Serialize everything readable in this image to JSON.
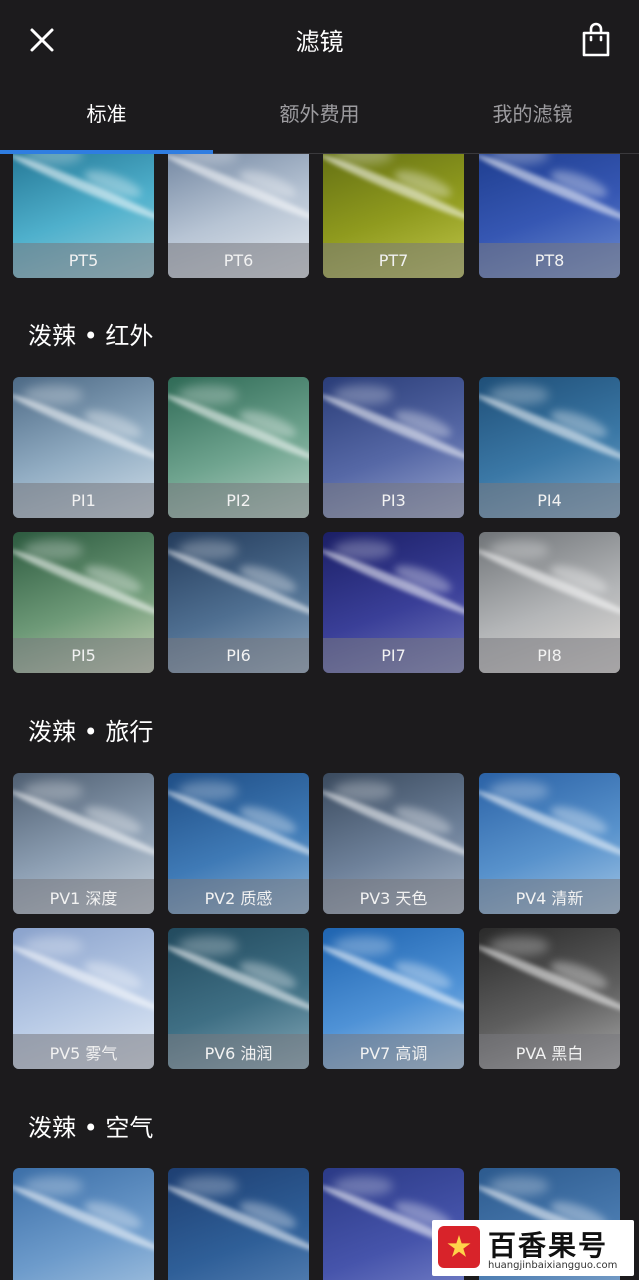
{
  "header": {
    "title": "滤镜",
    "close_icon": "close-icon",
    "store_icon": "shopping-bag-icon"
  },
  "tabs": [
    {
      "label": "标准",
      "active": true
    },
    {
      "label": "额外费用",
      "active": false
    },
    {
      "label": "我的滤镜",
      "active": false
    }
  ],
  "colors": {
    "background": "#1c1b1d",
    "accent": "#2f7de1"
  },
  "sections": [
    {
      "title": "",
      "filters": [
        {
          "label": "PT5",
          "tint": [
            "#1e6f8e",
            "#4fb0cc",
            "#9ad2de"
          ]
        },
        {
          "label": "PT6",
          "tint": [
            "#6a7f9b",
            "#b7c4d4",
            "#e5eaf0"
          ]
        },
        {
          "label": "PT7",
          "tint": [
            "#5e6a12",
            "#8f9a1e",
            "#c0c64a"
          ]
        },
        {
          "label": "PT8",
          "tint": [
            "#1b3a8a",
            "#3657b3",
            "#6f8ed1"
          ]
        }
      ]
    },
    {
      "title": "泼辣 • 红外",
      "filters": [
        {
          "label": "PI1",
          "tint": [
            "#4d6a86",
            "#93aec4",
            "#cfdde8"
          ]
        },
        {
          "label": "PI2",
          "tint": [
            "#2f6a56",
            "#6fa48f",
            "#b7d3c6"
          ]
        },
        {
          "label": "PI3",
          "tint": [
            "#2a3d78",
            "#5668a6",
            "#9aa6cf"
          ]
        },
        {
          "label": "PI4",
          "tint": [
            "#1f4f78",
            "#3b78a6",
            "#7aa8cc"
          ]
        },
        {
          "label": "PI5",
          "tint": [
            "#2c5a3f",
            "#6e9a78",
            "#c8d3b6"
          ]
        },
        {
          "label": "PI6",
          "tint": [
            "#243c5c",
            "#4f6f91",
            "#8fa8c0"
          ]
        },
        {
          "label": "PI7",
          "tint": [
            "#1b1f66",
            "#3a3f98",
            "#7479bd"
          ]
        },
        {
          "label": "PI8",
          "tint": [
            "#707478",
            "#b4b6b8",
            "#e0dcd8"
          ]
        }
      ]
    },
    {
      "title": "泼辣 • 旅行",
      "filters": [
        {
          "label": "PV1 深度",
          "tint": [
            "#4f5f72",
            "#8ea0b4",
            "#c8d2dc"
          ]
        },
        {
          "label": "PV2 质感",
          "tint": [
            "#1f4e86",
            "#3f7ab6",
            "#8db5d9"
          ]
        },
        {
          "label": "PV3 天色",
          "tint": [
            "#3a4a5e",
            "#6e819a",
            "#a9b7c8"
          ]
        },
        {
          "label": "PV4 清新",
          "tint": [
            "#2b62a6",
            "#5892cc",
            "#a3c6e6"
          ]
        },
        {
          "label": "PV5 雾气",
          "tint": [
            "#8aa2cc",
            "#b9cbe6",
            "#e3ebf6"
          ]
        },
        {
          "label": "PV6 油润",
          "tint": [
            "#224a5e",
            "#3f6f84",
            "#86a9b8"
          ]
        },
        {
          "label": "PV7 高调",
          "tint": [
            "#1f64b0",
            "#4f92d6",
            "#a9cdee"
          ]
        },
        {
          "label": "PVA 黑白",
          "tint": [
            "#2a2a2a",
            "#5e5e5e",
            "#a8a8a8"
          ]
        }
      ]
    },
    {
      "title": "泼辣 • 空气",
      "filters": [
        {
          "label": "",
          "tint": [
            "#3c6fa8",
            "#6d9bcb",
            "#a9c6e2"
          ]
        },
        {
          "label": "",
          "tint": [
            "#1e3f72",
            "#2f5f98",
            "#5d86b8"
          ]
        },
        {
          "label": "",
          "tint": [
            "#2b3a86",
            "#4654ab",
            "#7d88cc"
          ]
        },
        {
          "label": "",
          "tint": [
            "#2c5a8e",
            "#4a7bb0",
            "#86a9cf"
          ]
        }
      ]
    }
  ],
  "watermark": {
    "title": "百香果号",
    "url": "huangjinbaixiangguo.com"
  }
}
